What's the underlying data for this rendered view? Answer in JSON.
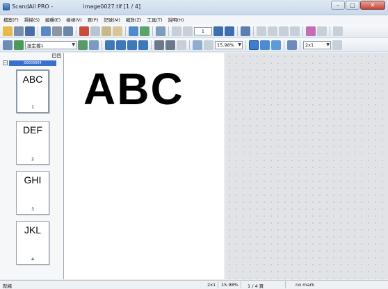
{
  "window": {
    "title_app": "ScandAll PRO -",
    "title_file": "image0027.tif [1 / 4]",
    "minimize": "–",
    "maximize": "□",
    "close": "✕"
  },
  "menu": [
    "檔案(F)",
    "掃描(S)",
    "編輯(E)",
    "檢視(V)",
    "頁(P)",
    "記號(M)",
    "縮放(Z)",
    "工具(T)",
    "說明(H)"
  ],
  "toolbar1": {
    "page_number": "1",
    "zoom": "15.98%",
    "view_mode": "2x1"
  },
  "toolbar2": {
    "profile": "設定檔1"
  },
  "thumbnails": {
    "document": "00000004",
    "pages": [
      {
        "text": "ABC",
        "num": "1"
      },
      {
        "text": "DEF",
        "num": "2"
      },
      {
        "text": "GHI",
        "num": "3"
      },
      {
        "text": "JKL",
        "num": "4"
      }
    ]
  },
  "document_text": "ABC",
  "status": {
    "main": "就緒",
    "view_mode": "2x1",
    "zoom": "15.98%",
    "page": "1 / 4 頁",
    "mark": "no mark"
  },
  "colors": {
    "accent": "#3a6fd0",
    "close": "#c4463a"
  }
}
